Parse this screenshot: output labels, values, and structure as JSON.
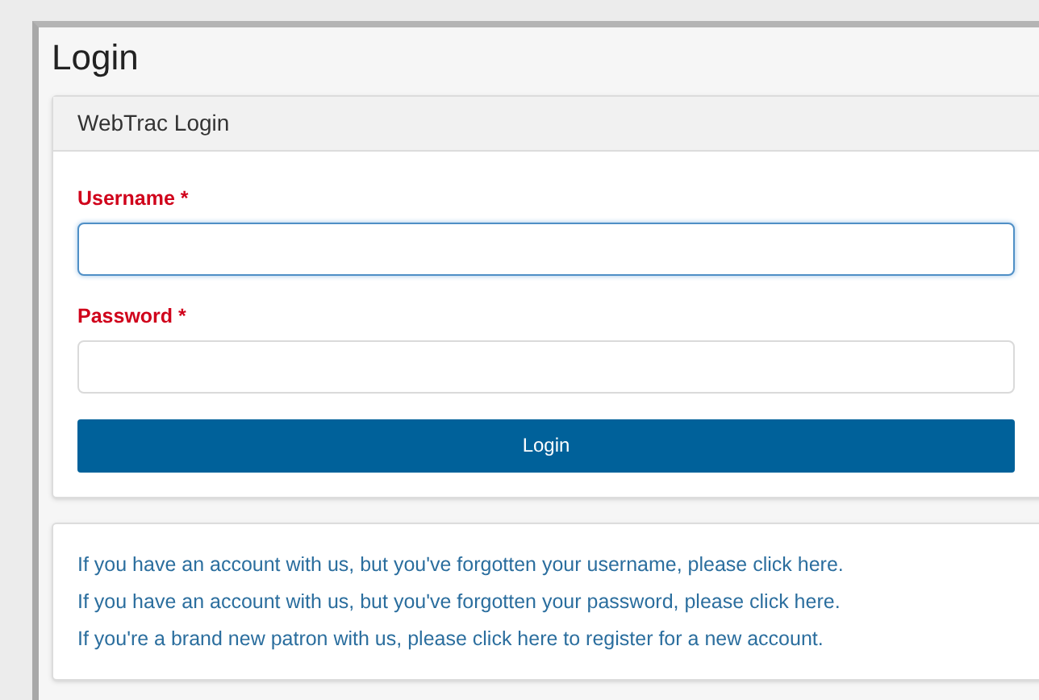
{
  "page": {
    "title": "Login"
  },
  "login_card": {
    "title": "WebTrac Login",
    "fields": [
      {
        "label": "Username *",
        "focused": true
      },
      {
        "label": "Password *",
        "focused": false
      }
    ],
    "submit_button": "Login"
  },
  "help_links": [
    "If you have an account with us, but you've forgotten your username, please click here.",
    "If you have an account with us, but you've forgotten your password, please click here.",
    "If you're a brand new patron with us, please click here to register for a new account."
  ]
}
